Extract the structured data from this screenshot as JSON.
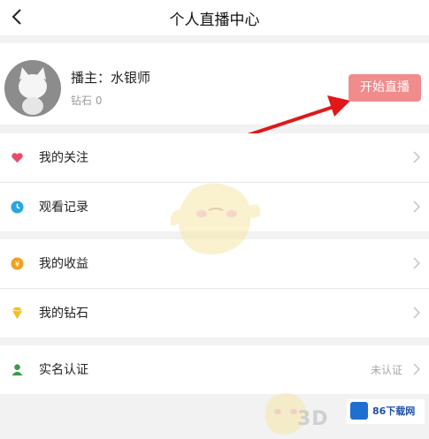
{
  "header": {
    "title": "个人直播中心",
    "back_icon": "chevron-left-icon"
  },
  "profile": {
    "host_label": "播主：水银师",
    "diamond_label": "钻石 0",
    "live_button_label": "开始直播",
    "accent_color": "#f08c8c"
  },
  "menu": {
    "follows": {
      "label": "我的关注",
      "icon": "heart-icon",
      "icon_color": "#e84c6a"
    },
    "history": {
      "label": "观看记录",
      "icon": "clock-icon",
      "icon_color": "#2aa6e0"
    },
    "earnings": {
      "label": "我的收益",
      "icon": "coin-icon",
      "icon_color": "#f0a020"
    },
    "diamonds": {
      "label": "我的钻石",
      "icon": "diamond-icon",
      "icon_color": "#f0c020"
    },
    "verify": {
      "label": "实名认证",
      "value": "未认证",
      "icon": "person-icon",
      "icon_color": "#3a9a4a"
    }
  },
  "watermark": {
    "brand_text": "86下载网",
    "site_text": "3D"
  }
}
